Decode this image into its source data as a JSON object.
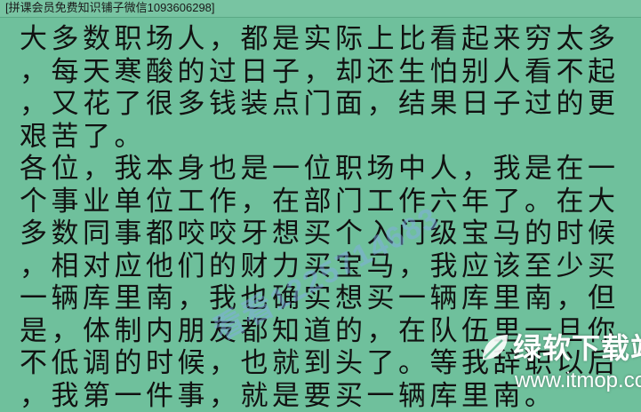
{
  "header": {
    "text": "[拼课会员免费知识铺子微信1093606298]"
  },
  "body_lines": [
    "大多数职场人，都是实际上比看起来穷太多",
    "，每天寒酸的过日子，却还生怕别人看不起",
    "，又花了很多钱装点门面，结果日子过的更",
    "艰苦了。",
    "各位，我本身也是一位职场中人，我是在一",
    "个事业单位工作，在部门工作六年了。在大",
    "多数同事都咬咬牙想买个入门级宝马的时候",
    "，相对应他们的财力买宝马，我应该至少买",
    "一辆库里南，我也确实想买一辆库里南，但",
    "是，体制内朋友都知道的，在队伍里一旦你",
    "不低调的时候，也就到头了。等我辞职以后",
    "，我第一件事，就是要买一辆库里南。"
  ],
  "watermarks": {
    "diagonal_text": "看看1225714683",
    "brand_title": "绿软下载站",
    "brand_url": "www.itmop.com"
  },
  "colors": {
    "background": "#6fc09c",
    "text": "#111111"
  }
}
